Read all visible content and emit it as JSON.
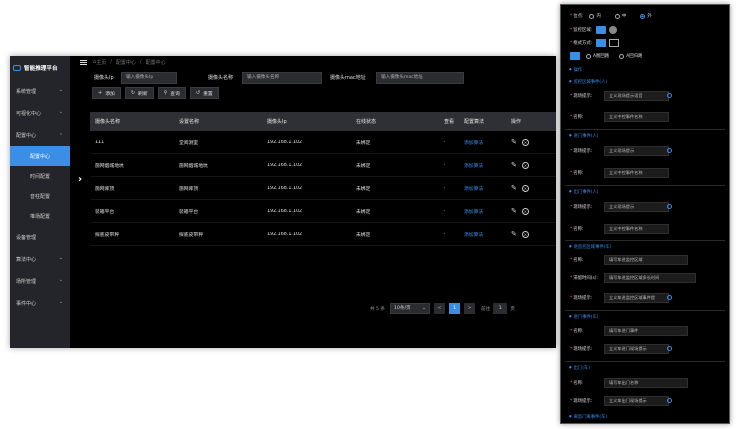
{
  "app": {
    "title": "智能推理平台"
  },
  "sidebar": {
    "items": [
      {
        "label": "系统管理",
        "chevron": "chevron-down-icon"
      },
      {
        "label": "可视化中心",
        "chevron": "chevron-down-icon"
      },
      {
        "label": "配置中心",
        "chevron": "chevron-up-icon"
      }
    ],
    "subitems": [
      {
        "label": "配置中心",
        "active": true
      },
      {
        "label": "时间配置"
      },
      {
        "label": "音柱配置"
      },
      {
        "label": "堆场配置"
      }
    ],
    "items2": [
      {
        "label": "设备管理",
        "chevron": ""
      },
      {
        "label": "算法中心",
        "chevron": "chevron-down-icon"
      },
      {
        "label": "场所管理",
        "chevron": "chevron-down-icon"
      },
      {
        "label": "事件中心",
        "chevron": "chevron-down-icon"
      }
    ]
  },
  "breadcrumb": {
    "home": "主页",
    "level1": "配置中心",
    "level2": "配置中心"
  },
  "filters": {
    "ip_label": "摄像头Ip",
    "ip_placeholder": "输入摄像头Ip",
    "name_label": "摄像头名称",
    "name_placeholder": "输入摄像头名称",
    "mac_label": "摄像头mac地址",
    "mac_placeholder": "输入摄像头mac地址"
  },
  "toolbar": {
    "add": "添加",
    "refresh": "刷新",
    "query": "查询",
    "reset": "重置"
  },
  "table": {
    "headers": [
      "摄像头名称",
      "设置名称",
      "摄像头Ip",
      "在线状态",
      "查看",
      "配置算法",
      "操作"
    ],
    "rows": [
      {
        "camera": "111",
        "setting": "堂阅测室",
        "ip": "192.168.1.102",
        "status": "未绑定",
        "view": "·",
        "algo": "添加算法"
      },
      {
        "camera": "施网烟城地坑",
        "setting": "施网烟城地坑",
        "ip": "192.168.1.102",
        "status": "未绑定",
        "view": "·",
        "algo": "添加算法"
      },
      {
        "camera": "施网库顶",
        "setting": "施网库顶",
        "ip": "192.168.1.102",
        "status": "未绑定",
        "view": "·",
        "algo": "添加算法"
      },
      {
        "camera": "装箱平台",
        "setting": "装箱平台",
        "ip": "192.168.1.102",
        "status": "未绑定",
        "view": "·",
        "algo": "添加算法"
      },
      {
        "camera": "探底皮带秤",
        "setting": "探底皮带秤",
        "ip": "192.168.1.102",
        "status": "未绑定",
        "view": "·",
        "algo": "添加算法"
      }
    ]
  },
  "pagination": {
    "total": "共 5 条",
    "page_size": "10条/页",
    "prev": "<",
    "current": "1",
    "next": ">",
    "goto_label": "前往",
    "goto_value": "1",
    "page_unit": "页"
  },
  "panel": {
    "position_label": "位点:",
    "position_options": [
      "内",
      "中",
      "外"
    ],
    "region_color_label": "监控区域:",
    "box_style_label": "框式方式:",
    "labels_opt1": "A图回路",
    "labels_opt2": "A回归路",
    "ops_label": "操作",
    "sections": [
      {
        "title": "监控区域事件(人)",
        "fields": [
          {
            "label": "现场提示:",
            "value": "立义现场提示语音"
          },
          {
            "label": "名称:",
            "value": "立义中控事件名称"
          }
        ]
      },
      {
        "title": "进门事件(人)",
        "fields": [
          {
            "label": "现场提示:",
            "value": "立义现场提示"
          },
          {
            "label": "名称:",
            "value": "立义中控事件名称"
          }
        ]
      },
      {
        "title": "出门事件(人)",
        "fields": [
          {
            "label": "现场提示:",
            "value": "立义现场提示"
          },
          {
            "label": "名称:",
            "value": "立义中控事件名称"
          }
        ]
      },
      {
        "title": "进监控区域事件(车)",
        "fields": [
          {
            "label": "名称:",
            "value": "填写车进监控区域"
          },
          {
            "label": "滞留时间(s):",
            "value": "填写车进监控区域多长时间"
          },
          {
            "label": "现场提示:",
            "value": "立义车进监控区域事件提"
          }
        ]
      },
      {
        "title": "进门事件(车)",
        "fields": [
          {
            "label": "名称:",
            "value": "填写车进门事件"
          },
          {
            "label": "现场提示:",
            "value": "立义车进门现场提示"
          }
        ]
      },
      {
        "title": "出门(车)",
        "fields": [
          {
            "label": "名称:",
            "value": "填写车出门名称"
          },
          {
            "label": "现场提示:",
            "value": "立义车出门现场提示"
          }
        ]
      },
      {
        "title": "离监门离事件(车)",
        "fields": []
      }
    ]
  },
  "colors": {
    "accent": "#3a8ee6",
    "sidebar": "#24252a",
    "danger": "#f56c6c"
  }
}
